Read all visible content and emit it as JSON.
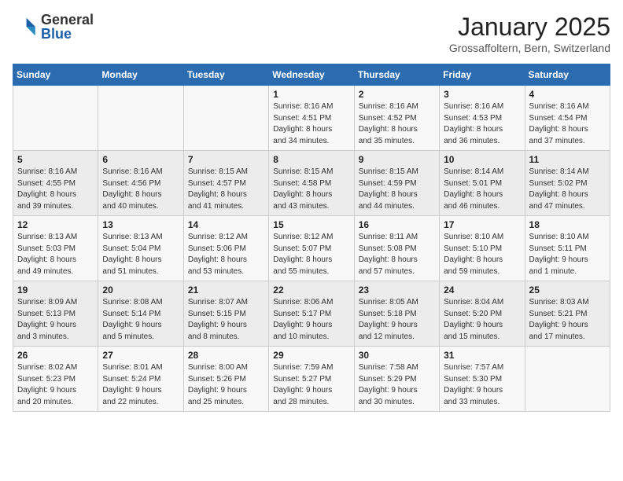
{
  "header": {
    "logo_general": "General",
    "logo_blue": "Blue",
    "month_title": "January 2025",
    "location": "Grossaffoltern, Bern, Switzerland"
  },
  "days_of_week": [
    "Sunday",
    "Monday",
    "Tuesday",
    "Wednesday",
    "Thursday",
    "Friday",
    "Saturday"
  ],
  "weeks": [
    [
      {
        "day": "",
        "info": ""
      },
      {
        "day": "",
        "info": ""
      },
      {
        "day": "",
        "info": ""
      },
      {
        "day": "1",
        "info": "Sunrise: 8:16 AM\nSunset: 4:51 PM\nDaylight: 8 hours\nand 34 minutes."
      },
      {
        "day": "2",
        "info": "Sunrise: 8:16 AM\nSunset: 4:52 PM\nDaylight: 8 hours\nand 35 minutes."
      },
      {
        "day": "3",
        "info": "Sunrise: 8:16 AM\nSunset: 4:53 PM\nDaylight: 8 hours\nand 36 minutes."
      },
      {
        "day": "4",
        "info": "Sunrise: 8:16 AM\nSunset: 4:54 PM\nDaylight: 8 hours\nand 37 minutes."
      }
    ],
    [
      {
        "day": "5",
        "info": "Sunrise: 8:16 AM\nSunset: 4:55 PM\nDaylight: 8 hours\nand 39 minutes."
      },
      {
        "day": "6",
        "info": "Sunrise: 8:16 AM\nSunset: 4:56 PM\nDaylight: 8 hours\nand 40 minutes."
      },
      {
        "day": "7",
        "info": "Sunrise: 8:15 AM\nSunset: 4:57 PM\nDaylight: 8 hours\nand 41 minutes."
      },
      {
        "day": "8",
        "info": "Sunrise: 8:15 AM\nSunset: 4:58 PM\nDaylight: 8 hours\nand 43 minutes."
      },
      {
        "day": "9",
        "info": "Sunrise: 8:15 AM\nSunset: 4:59 PM\nDaylight: 8 hours\nand 44 minutes."
      },
      {
        "day": "10",
        "info": "Sunrise: 8:14 AM\nSunset: 5:01 PM\nDaylight: 8 hours\nand 46 minutes."
      },
      {
        "day": "11",
        "info": "Sunrise: 8:14 AM\nSunset: 5:02 PM\nDaylight: 8 hours\nand 47 minutes."
      }
    ],
    [
      {
        "day": "12",
        "info": "Sunrise: 8:13 AM\nSunset: 5:03 PM\nDaylight: 8 hours\nand 49 minutes."
      },
      {
        "day": "13",
        "info": "Sunrise: 8:13 AM\nSunset: 5:04 PM\nDaylight: 8 hours\nand 51 minutes."
      },
      {
        "day": "14",
        "info": "Sunrise: 8:12 AM\nSunset: 5:06 PM\nDaylight: 8 hours\nand 53 minutes."
      },
      {
        "day": "15",
        "info": "Sunrise: 8:12 AM\nSunset: 5:07 PM\nDaylight: 8 hours\nand 55 minutes."
      },
      {
        "day": "16",
        "info": "Sunrise: 8:11 AM\nSunset: 5:08 PM\nDaylight: 8 hours\nand 57 minutes."
      },
      {
        "day": "17",
        "info": "Sunrise: 8:10 AM\nSunset: 5:10 PM\nDaylight: 8 hours\nand 59 minutes."
      },
      {
        "day": "18",
        "info": "Sunrise: 8:10 AM\nSunset: 5:11 PM\nDaylight: 9 hours\nand 1 minute."
      }
    ],
    [
      {
        "day": "19",
        "info": "Sunrise: 8:09 AM\nSunset: 5:13 PM\nDaylight: 9 hours\nand 3 minutes."
      },
      {
        "day": "20",
        "info": "Sunrise: 8:08 AM\nSunset: 5:14 PM\nDaylight: 9 hours\nand 5 minutes."
      },
      {
        "day": "21",
        "info": "Sunrise: 8:07 AM\nSunset: 5:15 PM\nDaylight: 9 hours\nand 8 minutes."
      },
      {
        "day": "22",
        "info": "Sunrise: 8:06 AM\nSunset: 5:17 PM\nDaylight: 9 hours\nand 10 minutes."
      },
      {
        "day": "23",
        "info": "Sunrise: 8:05 AM\nSunset: 5:18 PM\nDaylight: 9 hours\nand 12 minutes."
      },
      {
        "day": "24",
        "info": "Sunrise: 8:04 AM\nSunset: 5:20 PM\nDaylight: 9 hours\nand 15 minutes."
      },
      {
        "day": "25",
        "info": "Sunrise: 8:03 AM\nSunset: 5:21 PM\nDaylight: 9 hours\nand 17 minutes."
      }
    ],
    [
      {
        "day": "26",
        "info": "Sunrise: 8:02 AM\nSunset: 5:23 PM\nDaylight: 9 hours\nand 20 minutes."
      },
      {
        "day": "27",
        "info": "Sunrise: 8:01 AM\nSunset: 5:24 PM\nDaylight: 9 hours\nand 22 minutes."
      },
      {
        "day": "28",
        "info": "Sunrise: 8:00 AM\nSunset: 5:26 PM\nDaylight: 9 hours\nand 25 minutes."
      },
      {
        "day": "29",
        "info": "Sunrise: 7:59 AM\nSunset: 5:27 PM\nDaylight: 9 hours\nand 28 minutes."
      },
      {
        "day": "30",
        "info": "Sunrise: 7:58 AM\nSunset: 5:29 PM\nDaylight: 9 hours\nand 30 minutes."
      },
      {
        "day": "31",
        "info": "Sunrise: 7:57 AM\nSunset: 5:30 PM\nDaylight: 9 hours\nand 33 minutes."
      },
      {
        "day": "",
        "info": ""
      }
    ]
  ]
}
